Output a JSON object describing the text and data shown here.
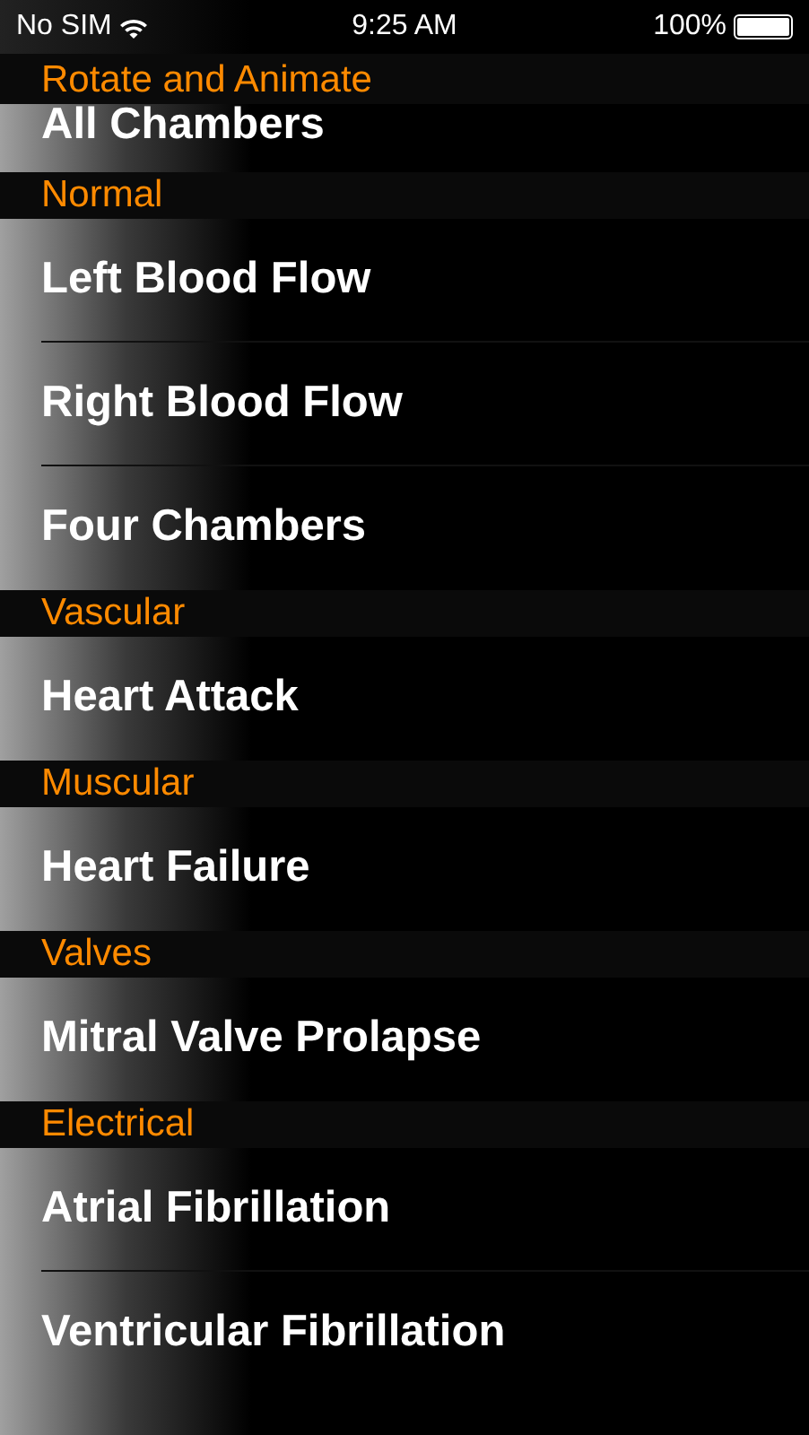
{
  "status_bar": {
    "carrier": "No SIM",
    "time": "9:25 AM",
    "battery": "100%"
  },
  "sections": [
    {
      "title": "Rotate and Animate",
      "items": [
        {
          "label": "All Chambers",
          "partially_hidden": true
        }
      ]
    },
    {
      "title": "Normal",
      "items": [
        {
          "label": "Left Blood Flow",
          "partially_hidden": false
        },
        {
          "label": "Right Blood Flow",
          "partially_hidden": false
        },
        {
          "label": "Four Chambers",
          "partially_hidden": false
        }
      ]
    },
    {
      "title": "Vascular",
      "items": [
        {
          "label": "Heart Attack",
          "partially_hidden": false
        }
      ]
    },
    {
      "title": "Muscular",
      "items": [
        {
          "label": "Heart Failure",
          "partially_hidden": false
        }
      ]
    },
    {
      "title": "Valves",
      "items": [
        {
          "label": "Mitral Valve Prolapse",
          "partially_hidden": false
        }
      ]
    },
    {
      "title": "Electrical",
      "items": [
        {
          "label": "Atrial Fibrillation",
          "partially_hidden": false
        },
        {
          "label": "Ventricular Fibrillation",
          "partially_hidden": false
        }
      ]
    }
  ]
}
